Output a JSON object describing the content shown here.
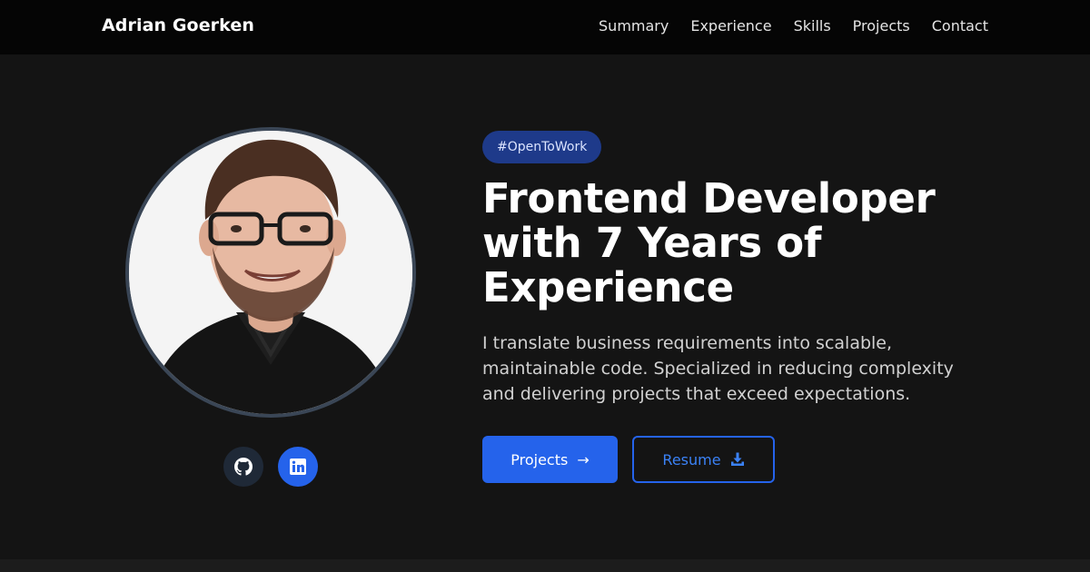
{
  "header": {
    "brand": "Adrian Goerken",
    "nav": [
      "Summary",
      "Experience",
      "Skills",
      "Projects",
      "Contact"
    ]
  },
  "hero": {
    "badge": "#OpenToWork",
    "headline_lines": [
      "Frontend Developer",
      "with 7 Years of",
      "Experience"
    ],
    "tagline_lines": [
      "I translate business requirements into scalable,",
      "maintainable code. Specialized in reducing complexity",
      "and delivering projects that exceed expectations."
    ],
    "buttons": {
      "projects_label": "Projects",
      "projects_arrow": "→",
      "resume_label": "Resume"
    },
    "social": [
      {
        "icon": "github-icon"
      },
      {
        "icon": "linkedin-icon"
      }
    ]
  },
  "colors": {
    "accent": "#2563eb",
    "background": "#141414",
    "header_background": "#050505",
    "badge_background": "#1e3a8a"
  }
}
